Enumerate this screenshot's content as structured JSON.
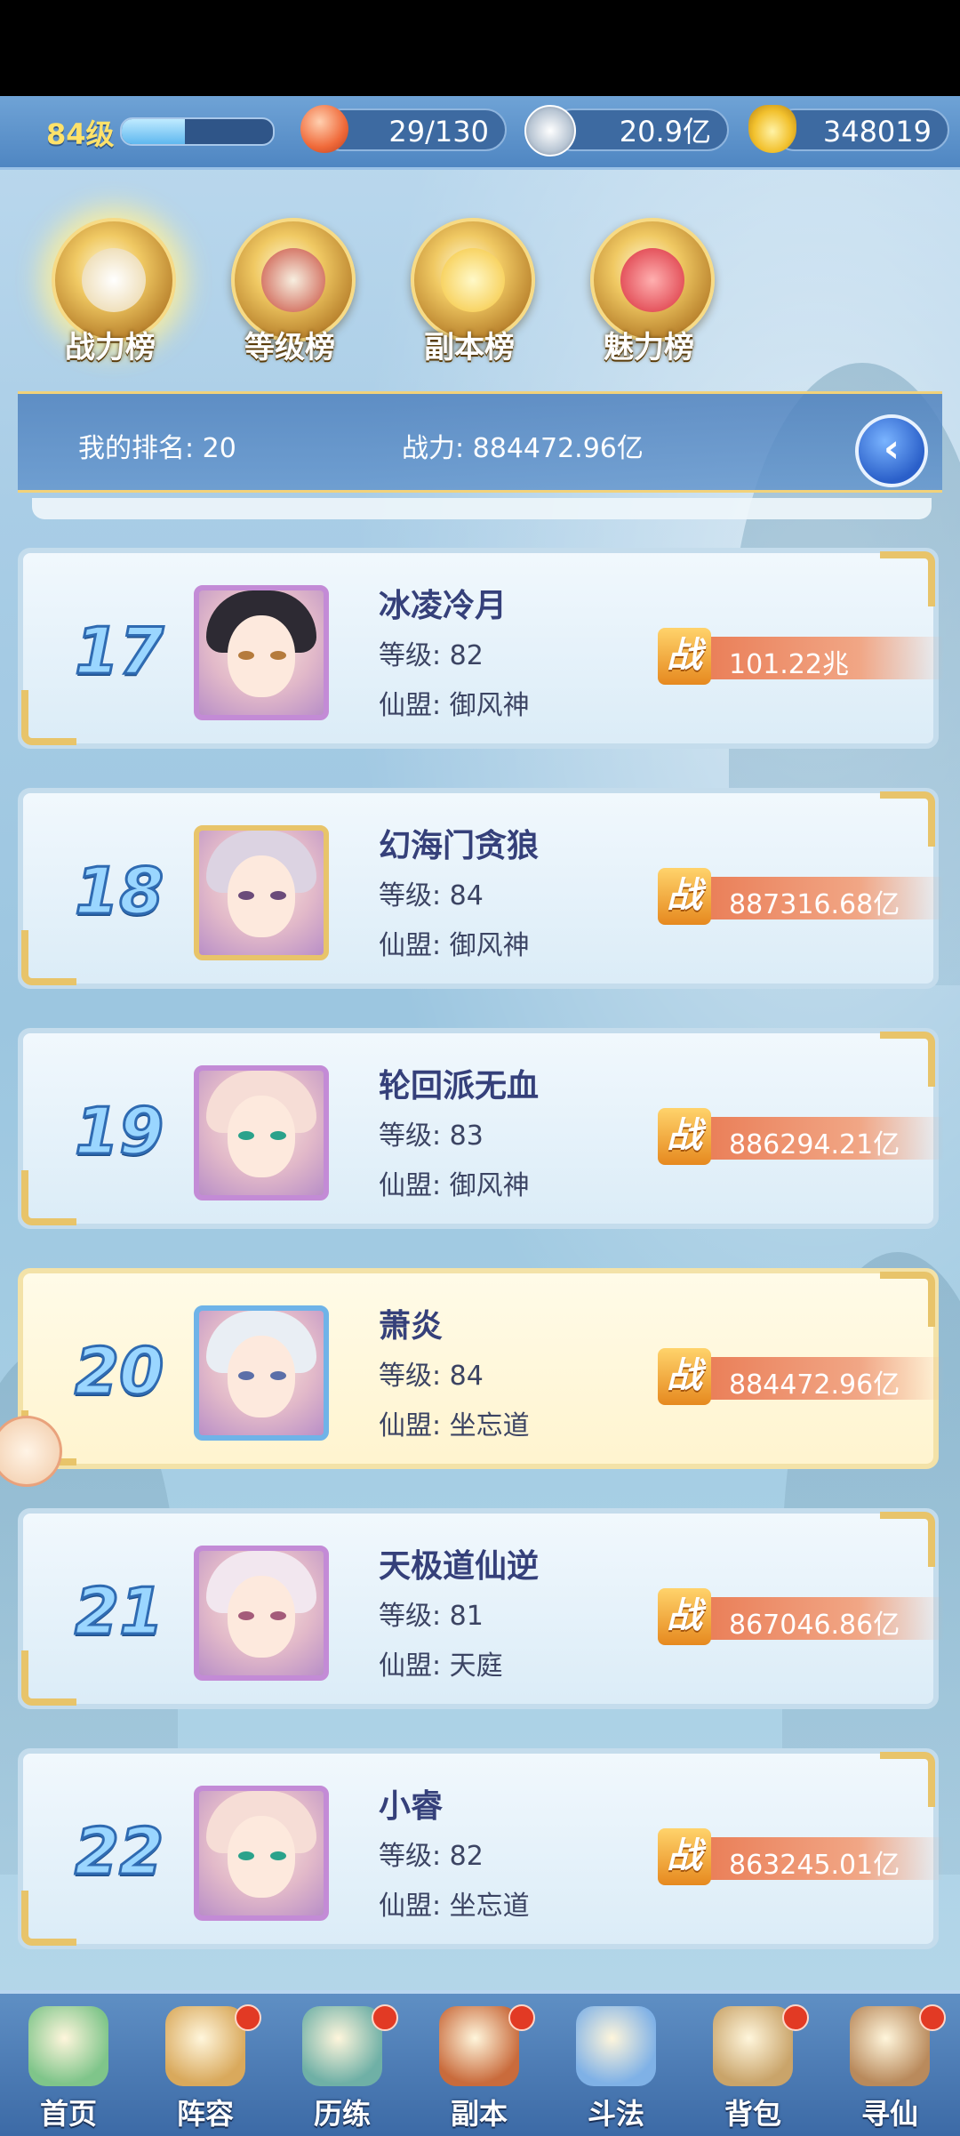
{
  "status": {
    "level": "84级",
    "xp_fraction": 0.42,
    "stamina": "29/130",
    "silver": "20.9亿",
    "gold": "348019"
  },
  "tabs": [
    {
      "label": "战力榜",
      "active": true
    },
    {
      "label": "等级榜",
      "active": false
    },
    {
      "label": "副本榜",
      "active": false
    },
    {
      "label": "魅力榜",
      "active": false
    }
  ],
  "my_rank": {
    "rank_text": "我的排名: 20",
    "power_text": "战力: 884472.96亿"
  },
  "power_badge": "战",
  "players": [
    {
      "rank": "17",
      "name": "冰凌冷月",
      "level": "等级: 82",
      "guild": "仙盟: 御风神",
      "power": "101.22兆"
    },
    {
      "rank": "18",
      "name": "幻海门贪狼",
      "level": "等级: 84",
      "guild": "仙盟: 御风神",
      "power": "887316.68亿"
    },
    {
      "rank": "19",
      "name": "轮回派无血",
      "level": "等级: 83",
      "guild": "仙盟: 御风神",
      "power": "886294.21亿"
    },
    {
      "rank": "20",
      "name": "萧炎",
      "level": "等级: 84",
      "guild": "仙盟: 坐忘道",
      "power": "884472.96亿"
    },
    {
      "rank": "21",
      "name": "天极道仙逆",
      "level": "等级: 81",
      "guild": "仙盟: 天庭",
      "power": "867046.86亿"
    },
    {
      "rank": "22",
      "name": "小睿",
      "level": "等级: 82",
      "guild": "仙盟: 坐忘道",
      "power": "863245.01亿"
    }
  ],
  "nav": [
    {
      "label": "首页",
      "badge": false
    },
    {
      "label": "阵容",
      "badge": true
    },
    {
      "label": "历练",
      "badge": true
    },
    {
      "label": "副本",
      "badge": true
    },
    {
      "label": "斗法",
      "badge": false
    },
    {
      "label": "背包",
      "badge": true
    },
    {
      "label": "寻仙",
      "badge": true
    }
  ]
}
